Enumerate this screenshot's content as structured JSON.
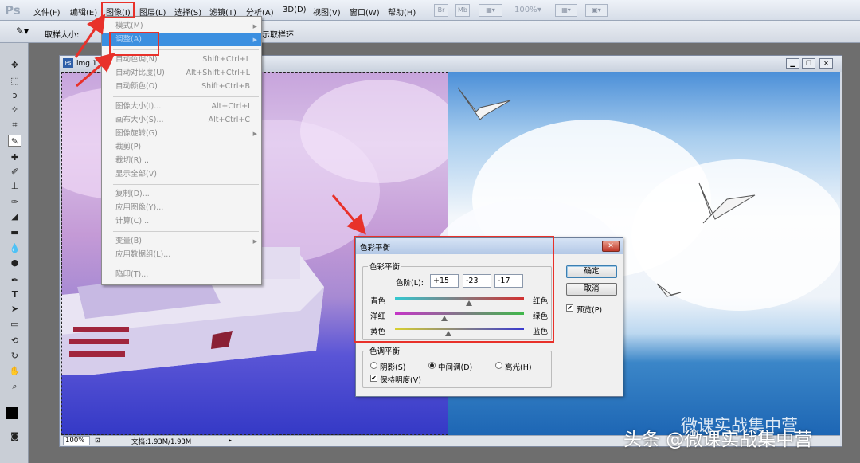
{
  "app": {
    "logo": "Ps"
  },
  "menubar": {
    "items": [
      "文件(F)",
      "编辑(E)",
      "图像(I)",
      "图层(L)",
      "选择(S)",
      "滤镜(T)",
      "分析(A)",
      "3D(D)",
      "视图(V)",
      "窗口(W)",
      "帮助(H)"
    ],
    "tb_buttons": [
      "Br",
      "Mb"
    ],
    "zoom": "100%"
  },
  "options": {
    "sample_size_label": "取样大小:",
    "sample_ring_label": "示取样环"
  },
  "image_menu": {
    "groups": [
      [
        {
          "label": "模式(M)",
          "shortcut": "",
          "submenu": true
        },
        {
          "label": "调整(A)",
          "shortcut": "",
          "submenu": true,
          "highlighted": true
        }
      ],
      [
        {
          "label": "自动色调(N)",
          "shortcut": "Shift+Ctrl+L"
        },
        {
          "label": "自动对比度(U)",
          "shortcut": "Alt+Shift+Ctrl+L"
        },
        {
          "label": "自动颜色(O)",
          "shortcut": "Shift+Ctrl+B"
        }
      ],
      [
        {
          "label": "图像大小(I)...",
          "shortcut": "Alt+Ctrl+I"
        },
        {
          "label": "画布大小(S)...",
          "shortcut": "Alt+Ctrl+C"
        },
        {
          "label": "图像旋转(G)",
          "shortcut": "",
          "submenu": true
        },
        {
          "label": "裁剪(P)",
          "shortcut": ""
        },
        {
          "label": "裁切(R)...",
          "shortcut": ""
        },
        {
          "label": "显示全部(V)",
          "shortcut": ""
        }
      ],
      [
        {
          "label": "复制(D)...",
          "shortcut": ""
        },
        {
          "label": "应用图像(Y)...",
          "shortcut": ""
        },
        {
          "label": "计算(C)...",
          "shortcut": ""
        }
      ],
      [
        {
          "label": "变量(B)",
          "shortcut": "",
          "submenu": true
        },
        {
          "label": "应用数据组(L)...",
          "shortcut": ""
        }
      ],
      [
        {
          "label": "陷印(T)...",
          "shortcut": ""
        }
      ]
    ]
  },
  "document": {
    "title": "img 1",
    "zoom": "100%",
    "doc_info": "文档:1.93M/1.93M"
  },
  "dialog": {
    "title": "色彩平衡",
    "balance_group": "色彩平衡",
    "levels_label": "色阶(L):",
    "levels": [
      "+15",
      "-23",
      "-17"
    ],
    "sliders": [
      {
        "left": "青色",
        "right": "红色",
        "value": 15,
        "colors": [
          "#34c8d0",
          "#d23030"
        ]
      },
      {
        "left": "洋红",
        "right": "绿色",
        "value": -23,
        "colors": [
          "#c535c7",
          "#3fb84a"
        ]
      },
      {
        "left": "黄色",
        "right": "蓝色",
        "value": -17,
        "colors": [
          "#d8d030",
          "#3a3ad0"
        ]
      }
    ],
    "tone_group": "色调平衡",
    "tones": [
      "阴影(S)",
      "中间调(D)",
      "高光(H)"
    ],
    "tone_selected": 1,
    "preserve_luminosity": "保持明度(V)",
    "ok": "确定",
    "cancel": "取消",
    "preview": "预览(P)"
  },
  "watermark": {
    "text": "头条 @微课实战集中营",
    "text2": "微课实战集中营"
  }
}
